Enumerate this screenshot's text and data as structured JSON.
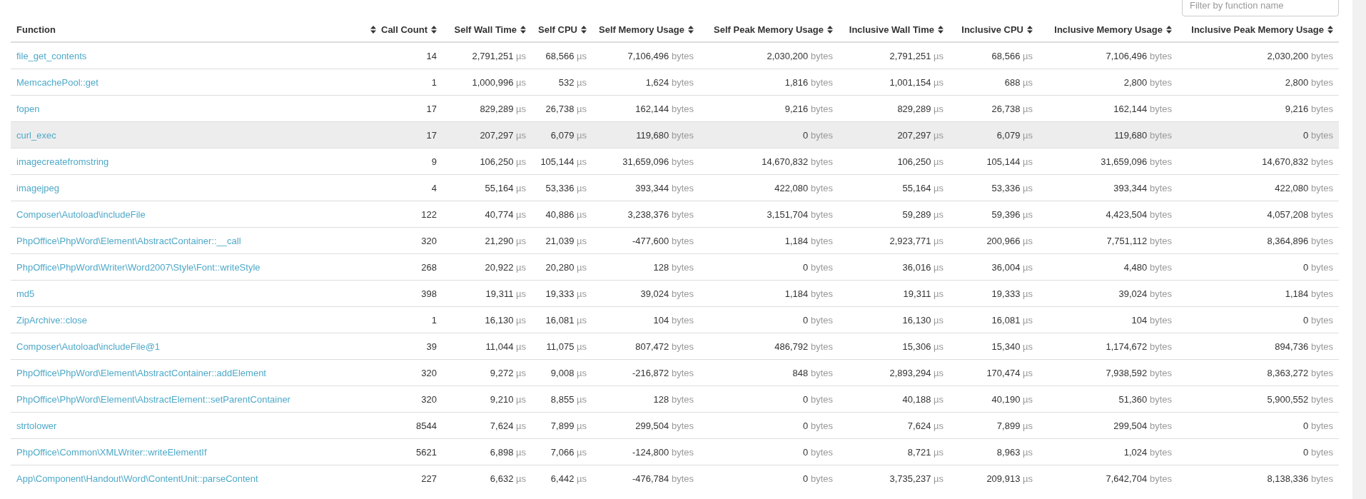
{
  "filter": {
    "placeholder": "Filter by function name"
  },
  "columns": [
    "Function",
    "Call Count",
    "Self Wall Time",
    "Self CPU",
    "Self Memory Usage",
    "Self Peak Memory Usage",
    "Inclusive Wall Time",
    "Inclusive CPU",
    "Inclusive Memory Usage",
    "Inclusive Peak Memory Usage"
  ],
  "rows": [
    {
      "function": "file_get_contents",
      "call_count": "14",
      "highlighted": false,
      "metrics": [
        {
          "value": "2,791,251",
          "unit": "µs"
        },
        {
          "value": "68,566",
          "unit": "µs"
        },
        {
          "value": "7,106,496",
          "unit": "bytes"
        },
        {
          "value": "2,030,200",
          "unit": "bytes"
        },
        {
          "value": "2,791,251",
          "unit": "µs"
        },
        {
          "value": "68,566",
          "unit": "µs"
        },
        {
          "value": "7,106,496",
          "unit": "bytes"
        },
        {
          "value": "2,030,200",
          "unit": "bytes"
        }
      ]
    },
    {
      "function": "MemcachePool::get",
      "call_count": "1",
      "highlighted": false,
      "metrics": [
        {
          "value": "1,000,996",
          "unit": "µs"
        },
        {
          "value": "532",
          "unit": "µs"
        },
        {
          "value": "1,624",
          "unit": "bytes"
        },
        {
          "value": "1,816",
          "unit": "bytes"
        },
        {
          "value": "1,001,154",
          "unit": "µs"
        },
        {
          "value": "688",
          "unit": "µs"
        },
        {
          "value": "2,800",
          "unit": "bytes"
        },
        {
          "value": "2,800",
          "unit": "bytes"
        }
      ]
    },
    {
      "function": "fopen",
      "call_count": "17",
      "highlighted": false,
      "metrics": [
        {
          "value": "829,289",
          "unit": "µs"
        },
        {
          "value": "26,738",
          "unit": "µs"
        },
        {
          "value": "162,144",
          "unit": "bytes"
        },
        {
          "value": "9,216",
          "unit": "bytes"
        },
        {
          "value": "829,289",
          "unit": "µs"
        },
        {
          "value": "26,738",
          "unit": "µs"
        },
        {
          "value": "162,144",
          "unit": "bytes"
        },
        {
          "value": "9,216",
          "unit": "bytes"
        }
      ]
    },
    {
      "function": "curl_exec",
      "call_count": "17",
      "highlighted": true,
      "metrics": [
        {
          "value": "207,297",
          "unit": "µs"
        },
        {
          "value": "6,079",
          "unit": "µs"
        },
        {
          "value": "119,680",
          "unit": "bytes"
        },
        {
          "value": "0",
          "unit": "bytes"
        },
        {
          "value": "207,297",
          "unit": "µs"
        },
        {
          "value": "6,079",
          "unit": "µs"
        },
        {
          "value": "119,680",
          "unit": "bytes"
        },
        {
          "value": "0",
          "unit": "bytes"
        }
      ]
    },
    {
      "function": "imagecreatefromstring",
      "call_count": "9",
      "highlighted": false,
      "metrics": [
        {
          "value": "106,250",
          "unit": "µs"
        },
        {
          "value": "105,144",
          "unit": "µs"
        },
        {
          "value": "31,659,096",
          "unit": "bytes"
        },
        {
          "value": "14,670,832",
          "unit": "bytes"
        },
        {
          "value": "106,250",
          "unit": "µs"
        },
        {
          "value": "105,144",
          "unit": "µs"
        },
        {
          "value": "31,659,096",
          "unit": "bytes"
        },
        {
          "value": "14,670,832",
          "unit": "bytes"
        }
      ]
    },
    {
      "function": "imagejpeg",
      "call_count": "4",
      "highlighted": false,
      "metrics": [
        {
          "value": "55,164",
          "unit": "µs"
        },
        {
          "value": "53,336",
          "unit": "µs"
        },
        {
          "value": "393,344",
          "unit": "bytes"
        },
        {
          "value": "422,080",
          "unit": "bytes"
        },
        {
          "value": "55,164",
          "unit": "µs"
        },
        {
          "value": "53,336",
          "unit": "µs"
        },
        {
          "value": "393,344",
          "unit": "bytes"
        },
        {
          "value": "422,080",
          "unit": "bytes"
        }
      ]
    },
    {
      "function": "Composer\\Autoload\\includeFile",
      "call_count": "122",
      "highlighted": false,
      "metrics": [
        {
          "value": "40,774",
          "unit": "µs"
        },
        {
          "value": "40,886",
          "unit": "µs"
        },
        {
          "value": "3,238,376",
          "unit": "bytes"
        },
        {
          "value": "3,151,704",
          "unit": "bytes"
        },
        {
          "value": "59,289",
          "unit": "µs"
        },
        {
          "value": "59,396",
          "unit": "µs"
        },
        {
          "value": "4,423,504",
          "unit": "bytes"
        },
        {
          "value": "4,057,208",
          "unit": "bytes"
        }
      ]
    },
    {
      "function": "PhpOffice\\PhpWord\\Element\\AbstractContainer::__call",
      "call_count": "320",
      "highlighted": false,
      "metrics": [
        {
          "value": "21,290",
          "unit": "µs"
        },
        {
          "value": "21,039",
          "unit": "µs"
        },
        {
          "value": "-477,600",
          "unit": "bytes"
        },
        {
          "value": "1,184",
          "unit": "bytes"
        },
        {
          "value": "2,923,771",
          "unit": "µs"
        },
        {
          "value": "200,966",
          "unit": "µs"
        },
        {
          "value": "7,751,112",
          "unit": "bytes"
        },
        {
          "value": "8,364,896",
          "unit": "bytes"
        }
      ]
    },
    {
      "function": "PhpOffice\\PhpWord\\Writer\\Word2007\\Style\\Font::writeStyle",
      "call_count": "268",
      "highlighted": false,
      "metrics": [
        {
          "value": "20,922",
          "unit": "µs"
        },
        {
          "value": "20,280",
          "unit": "µs"
        },
        {
          "value": "128",
          "unit": "bytes"
        },
        {
          "value": "0",
          "unit": "bytes"
        },
        {
          "value": "36,016",
          "unit": "µs"
        },
        {
          "value": "36,004",
          "unit": "µs"
        },
        {
          "value": "4,480",
          "unit": "bytes"
        },
        {
          "value": "0",
          "unit": "bytes"
        }
      ]
    },
    {
      "function": "md5",
      "call_count": "398",
      "highlighted": false,
      "metrics": [
        {
          "value": "19,311",
          "unit": "µs"
        },
        {
          "value": "19,333",
          "unit": "µs"
        },
        {
          "value": "39,024",
          "unit": "bytes"
        },
        {
          "value": "1,184",
          "unit": "bytes"
        },
        {
          "value": "19,311",
          "unit": "µs"
        },
        {
          "value": "19,333",
          "unit": "µs"
        },
        {
          "value": "39,024",
          "unit": "bytes"
        },
        {
          "value": "1,184",
          "unit": "bytes"
        }
      ]
    },
    {
      "function": "ZipArchive::close",
      "call_count": "1",
      "highlighted": false,
      "metrics": [
        {
          "value": "16,130",
          "unit": "µs"
        },
        {
          "value": "16,081",
          "unit": "µs"
        },
        {
          "value": "104",
          "unit": "bytes"
        },
        {
          "value": "0",
          "unit": "bytes"
        },
        {
          "value": "16,130",
          "unit": "µs"
        },
        {
          "value": "16,081",
          "unit": "µs"
        },
        {
          "value": "104",
          "unit": "bytes"
        },
        {
          "value": "0",
          "unit": "bytes"
        }
      ]
    },
    {
      "function": "Composer\\Autoload\\includeFile@1",
      "call_count": "39",
      "highlighted": false,
      "metrics": [
        {
          "value": "11,044",
          "unit": "µs"
        },
        {
          "value": "11,075",
          "unit": "µs"
        },
        {
          "value": "807,472",
          "unit": "bytes"
        },
        {
          "value": "486,792",
          "unit": "bytes"
        },
        {
          "value": "15,306",
          "unit": "µs"
        },
        {
          "value": "15,340",
          "unit": "µs"
        },
        {
          "value": "1,174,672",
          "unit": "bytes"
        },
        {
          "value": "894,736",
          "unit": "bytes"
        }
      ]
    },
    {
      "function": "PhpOffice\\PhpWord\\Element\\AbstractContainer::addElement",
      "call_count": "320",
      "highlighted": false,
      "metrics": [
        {
          "value": "9,272",
          "unit": "µs"
        },
        {
          "value": "9,008",
          "unit": "µs"
        },
        {
          "value": "-216,872",
          "unit": "bytes"
        },
        {
          "value": "848",
          "unit": "bytes"
        },
        {
          "value": "2,893,294",
          "unit": "µs"
        },
        {
          "value": "170,474",
          "unit": "µs"
        },
        {
          "value": "7,938,592",
          "unit": "bytes"
        },
        {
          "value": "8,363,272",
          "unit": "bytes"
        }
      ]
    },
    {
      "function": "PhpOffice\\PhpWord\\Element\\AbstractElement::setParentContainer",
      "call_count": "320",
      "highlighted": false,
      "metrics": [
        {
          "value": "9,210",
          "unit": "µs"
        },
        {
          "value": "8,855",
          "unit": "µs"
        },
        {
          "value": "128",
          "unit": "bytes"
        },
        {
          "value": "0",
          "unit": "bytes"
        },
        {
          "value": "40,188",
          "unit": "µs"
        },
        {
          "value": "40,190",
          "unit": "µs"
        },
        {
          "value": "51,360",
          "unit": "bytes"
        },
        {
          "value": "5,900,552",
          "unit": "bytes"
        }
      ]
    },
    {
      "function": "strtolower",
      "call_count": "8544",
      "highlighted": false,
      "metrics": [
        {
          "value": "7,624",
          "unit": "µs"
        },
        {
          "value": "7,899",
          "unit": "µs"
        },
        {
          "value": "299,504",
          "unit": "bytes"
        },
        {
          "value": "0",
          "unit": "bytes"
        },
        {
          "value": "7,624",
          "unit": "µs"
        },
        {
          "value": "7,899",
          "unit": "µs"
        },
        {
          "value": "299,504",
          "unit": "bytes"
        },
        {
          "value": "0",
          "unit": "bytes"
        }
      ]
    },
    {
      "function": "PhpOffice\\Common\\XMLWriter::writeElementIf",
      "call_count": "5621",
      "highlighted": false,
      "metrics": [
        {
          "value": "6,898",
          "unit": "µs"
        },
        {
          "value": "7,066",
          "unit": "µs"
        },
        {
          "value": "-124,800",
          "unit": "bytes"
        },
        {
          "value": "0",
          "unit": "bytes"
        },
        {
          "value": "8,721",
          "unit": "µs"
        },
        {
          "value": "8,963",
          "unit": "µs"
        },
        {
          "value": "1,024",
          "unit": "bytes"
        },
        {
          "value": "0",
          "unit": "bytes"
        }
      ]
    },
    {
      "function": "App\\Component\\Handout\\Word\\ContentUnit::parseContent",
      "call_count": "227",
      "highlighted": false,
      "metrics": [
        {
          "value": "6,632",
          "unit": "µs"
        },
        {
          "value": "6,442",
          "unit": "µs"
        },
        {
          "value": "-476,784",
          "unit": "bytes"
        },
        {
          "value": "0",
          "unit": "bytes"
        },
        {
          "value": "3,735,237",
          "unit": "µs"
        },
        {
          "value": "209,913",
          "unit": "µs"
        },
        {
          "value": "7,642,704",
          "unit": "bytes"
        },
        {
          "value": "8,138,336",
          "unit": "bytes"
        }
      ]
    }
  ]
}
